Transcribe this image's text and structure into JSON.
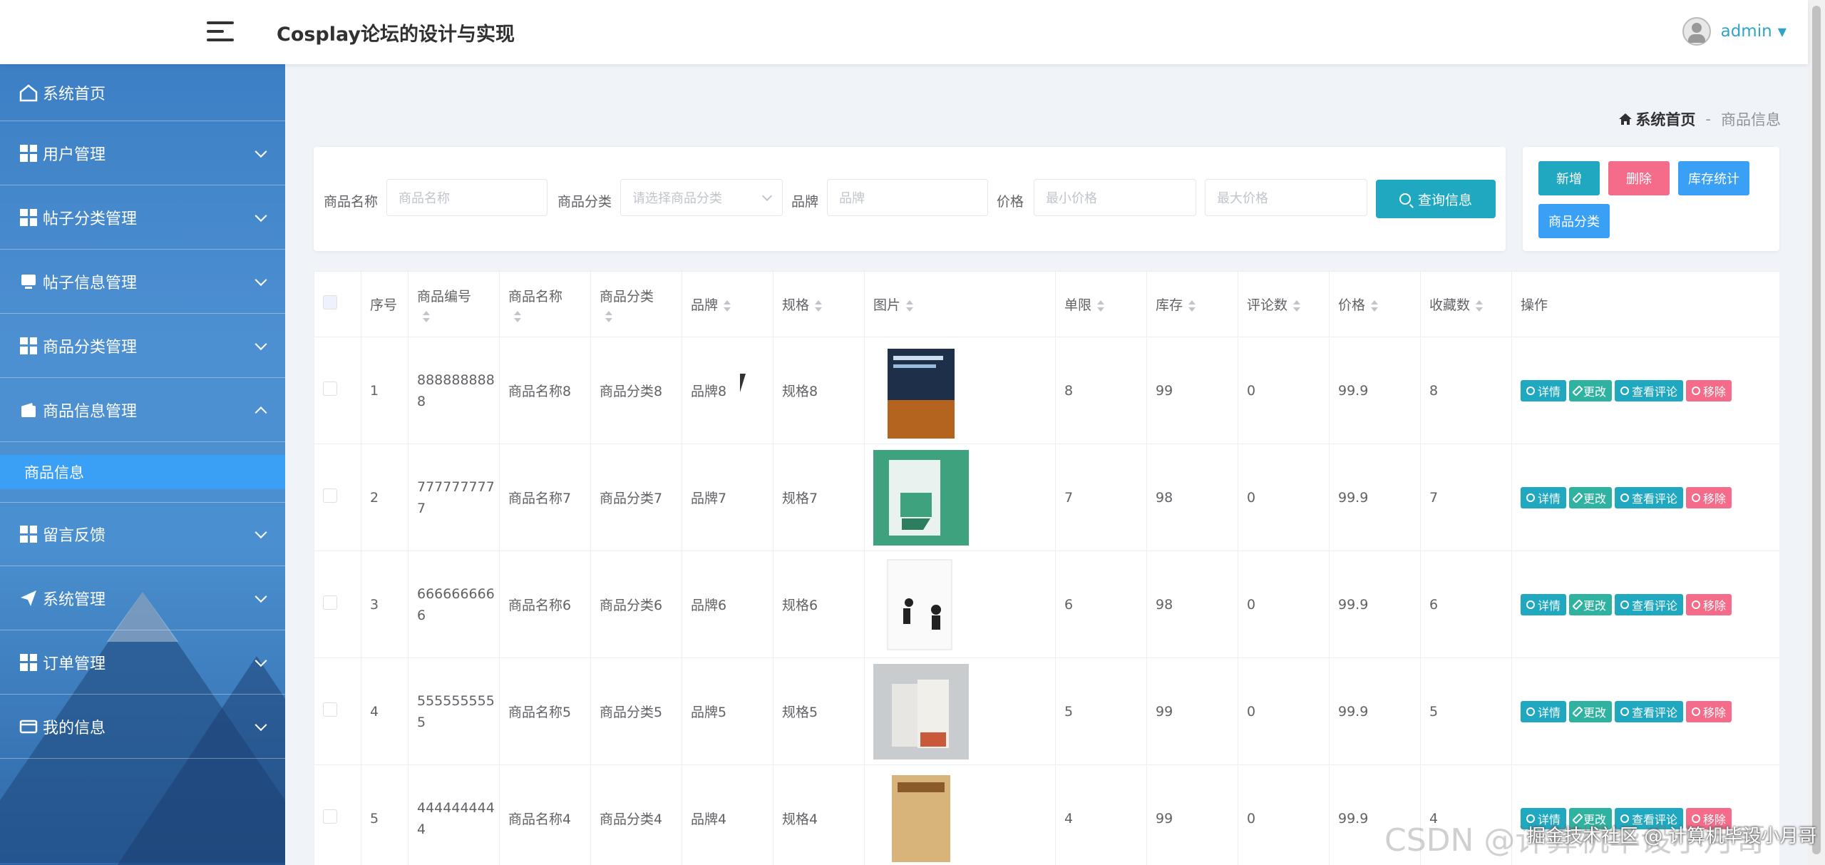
{
  "header": {
    "title": "Cosplay论坛的设计与实现",
    "user": "admin"
  },
  "sidebar": {
    "items": [
      {
        "label": "系统首页",
        "icon": "home-icon"
      },
      {
        "label": "用户管理",
        "icon": "grid-icon"
      },
      {
        "label": "帖子分类管理",
        "icon": "grid-icon"
      },
      {
        "label": "帖子信息管理",
        "icon": "monitor-icon"
      },
      {
        "label": "商品分类管理",
        "icon": "grid-icon"
      },
      {
        "label": "商品信息管理",
        "icon": "wallet-icon",
        "expanded": true
      },
      {
        "label": "留言反馈",
        "icon": "grid-icon"
      },
      {
        "label": "系统管理",
        "icon": "send-icon"
      },
      {
        "label": "订单管理",
        "icon": "grid-icon"
      },
      {
        "label": "我的信息",
        "icon": "card-icon"
      }
    ],
    "sub_item": "商品信息"
  },
  "breadcrumb": {
    "home": "系统首页",
    "separator": "-",
    "current": "商品信息"
  },
  "search": {
    "name_label": "商品名称",
    "name_placeholder": "商品名称",
    "category_label": "商品分类",
    "category_placeholder": "请选择商品分类",
    "brand_label": "品牌",
    "brand_placeholder": "品牌",
    "price_label": "价格",
    "min_placeholder": "最小价格",
    "max_placeholder": "最大价格",
    "button": "查询信息"
  },
  "actions": {
    "add": "新增",
    "delete": "删除",
    "stock": "库存统计",
    "category": "商品分类"
  },
  "colors": {
    "primary": "#1fa8c0",
    "danger": "#f56c8a",
    "info": "#3aa0f5",
    "sidebar": "#4a8fcf"
  },
  "table": {
    "headers": [
      "序号",
      "商品编号",
      "商品名称",
      "商品分类",
      "品牌",
      "规格",
      "图片",
      "单限",
      "库存",
      "评论数",
      "价格",
      "收藏数",
      "操作"
    ],
    "ops": {
      "detail": "详情",
      "edit": "更改",
      "comments": "查看评论",
      "remove": "移除"
    },
    "rows": [
      {
        "index": "1",
        "code": "8888888888",
        "name": "商品名称8",
        "category": "商品分类8",
        "brand": "品牌8",
        "spec": "规格8",
        "limit": "8",
        "stock": "99",
        "comments": "0",
        "price": "99.9",
        "favorites": "8"
      },
      {
        "index": "2",
        "code": "7777777777",
        "name": "商品名称7",
        "category": "商品分类7",
        "brand": "品牌7",
        "spec": "规格7",
        "limit": "7",
        "stock": "98",
        "comments": "0",
        "price": "99.9",
        "favorites": "7"
      },
      {
        "index": "3",
        "code": "6666666666",
        "name": "商品名称6",
        "category": "商品分类6",
        "brand": "品牌6",
        "spec": "规格6",
        "limit": "6",
        "stock": "98",
        "comments": "0",
        "price": "99.9",
        "favorites": "6"
      },
      {
        "index": "4",
        "code": "5555555555",
        "name": "商品名称5",
        "category": "商品分类5",
        "brand": "品牌5",
        "spec": "规格5",
        "limit": "5",
        "stock": "99",
        "comments": "0",
        "price": "99.9",
        "favorites": "5"
      },
      {
        "index": "5",
        "code": "4444444444",
        "name": "商品名称4",
        "category": "商品分类4",
        "brand": "品牌4",
        "spec": "规格4",
        "limit": "4",
        "stock": "99",
        "comments": "0",
        "price": "99.9",
        "favorites": "4"
      }
    ]
  },
  "watermark": "CSDN @计算机毕设小月哥",
  "watermark2": "掘金技术社区 @ 计算机毕设小月哥"
}
